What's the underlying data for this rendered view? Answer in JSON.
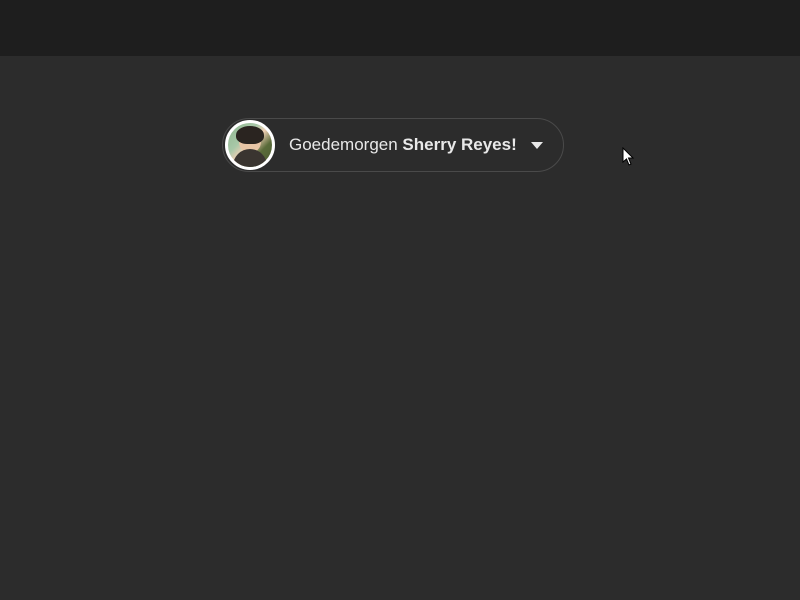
{
  "greeting": {
    "prefix": "Goedemorgen ",
    "name": "Sherry Reyes!",
    "avatar_alt": "user-avatar"
  }
}
